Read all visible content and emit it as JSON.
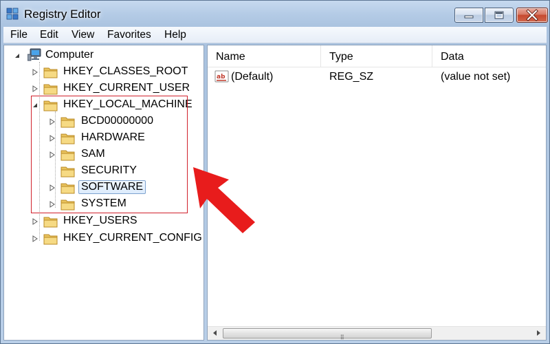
{
  "window": {
    "title": "Registry Editor"
  },
  "menu": [
    "File",
    "Edit",
    "View",
    "Favorites",
    "Help"
  ],
  "tree": {
    "root": "Computer",
    "hives": {
      "classes_root": "HKEY_CLASSES_ROOT",
      "current_user": "HKEY_CURRENT_USER",
      "local_machine": "HKEY_LOCAL_MACHINE",
      "users": "HKEY_USERS",
      "current_config": "HKEY_CURRENT_CONFIG"
    },
    "local_machine_children": [
      "BCD00000000",
      "HARDWARE",
      "SAM",
      "SECURITY",
      "SOFTWARE",
      "SYSTEM"
    ],
    "selected": "SOFTWARE"
  },
  "list": {
    "columns": [
      "Name",
      "Type",
      "Data"
    ],
    "rows": [
      {
        "name": "(Default)",
        "type": "REG_SZ",
        "data": "(value not set)"
      }
    ]
  },
  "annotation": {
    "highlight_color": "#d01f2a",
    "arrow_color": "#e81c1c"
  }
}
